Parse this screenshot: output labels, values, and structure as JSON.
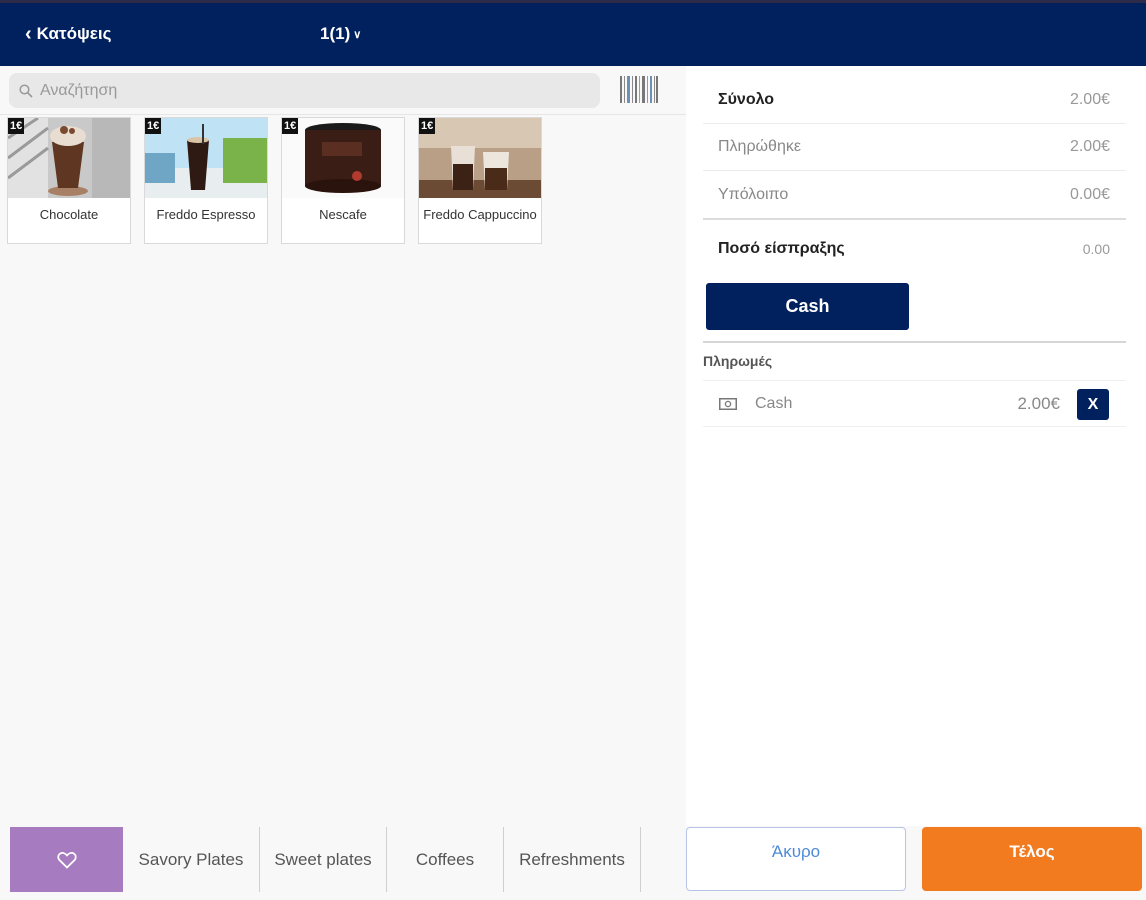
{
  "header": {
    "back_label": "Κατόψεις",
    "table_label": "1(1)"
  },
  "search": {
    "placeholder": "Αναζήτηση"
  },
  "products": [
    {
      "name": "Chocolate",
      "price": "1€"
    },
    {
      "name": "Freddo Espresso",
      "price": "1€"
    },
    {
      "name": "Nescafe",
      "price": "1€"
    },
    {
      "name": "Freddo Cappuccino",
      "price": "1€"
    }
  ],
  "summary": {
    "total_label": "Σύνολο",
    "total_value": "2.00€",
    "paid_label": "Πληρώθηκε",
    "paid_value": "2.00€",
    "balance_label": "Υπόλοιπο",
    "balance_value": "0.00€",
    "amount_label": "Ποσό είσπραξης",
    "amount_value": "0.00"
  },
  "cash_button_label": "Cash",
  "payments": {
    "heading": "Πληρωμές",
    "items": [
      {
        "method": "Cash",
        "amount": "2.00€",
        "icon": "money-icon",
        "remove_label": "X"
      }
    ]
  },
  "categories": {
    "favorites_icon": "heart-icon",
    "items": [
      "Savory Plates",
      "Sweet plates",
      "Coffees",
      "Refreshments"
    ]
  },
  "actions": {
    "cancel_label": "Άκυρο",
    "finish_label": "Τέλος"
  },
  "colors": {
    "navy": "#00215e",
    "orange": "#f27a1f",
    "purple": "#a67bbf",
    "cancel_text": "#4e8bd6"
  }
}
